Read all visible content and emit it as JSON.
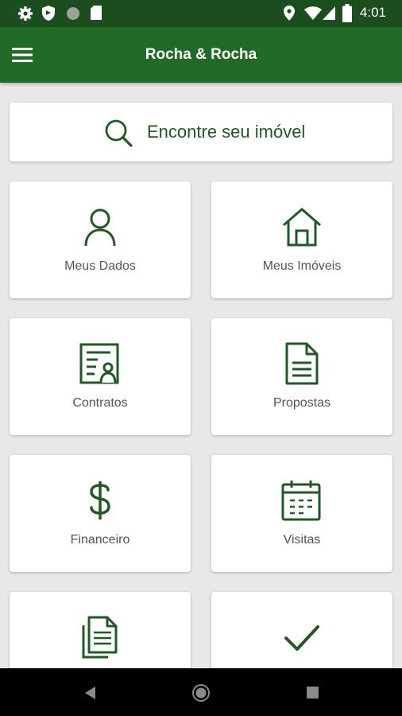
{
  "status": {
    "time": "4:01",
    "left_icons": [
      "gear-icon",
      "shield-icon",
      "circle-icon",
      "sd-card-icon"
    ],
    "right_icons": [
      "location-icon",
      "wifi-icon",
      "signal-icon",
      "battery-icon"
    ]
  },
  "appbar": {
    "title": "Rocha & Rocha",
    "menu_icon": "hamburger-menu-icon"
  },
  "search": {
    "label": "Encontre seu imóvel",
    "icon": "search-icon"
  },
  "menu": {
    "items": [
      {
        "label": "Meus Dados",
        "icon": "user-icon"
      },
      {
        "label": "Meus Imóveis",
        "icon": "home-icon"
      },
      {
        "label": "Contratos",
        "icon": "contract-icon"
      },
      {
        "label": "Propostas",
        "icon": "document-icon"
      },
      {
        "label": "Financeiro",
        "icon": "dollar-icon"
      },
      {
        "label": "Visitas",
        "icon": "calendar-icon"
      },
      {
        "label": "",
        "icon": "documents-icon"
      },
      {
        "label": "",
        "icon": "check-icon"
      }
    ]
  },
  "colors": {
    "status_bar": "#1b4d1e",
    "app_bar": "#226b26",
    "accent": "#1e5a22",
    "background": "#e8e8e8"
  }
}
